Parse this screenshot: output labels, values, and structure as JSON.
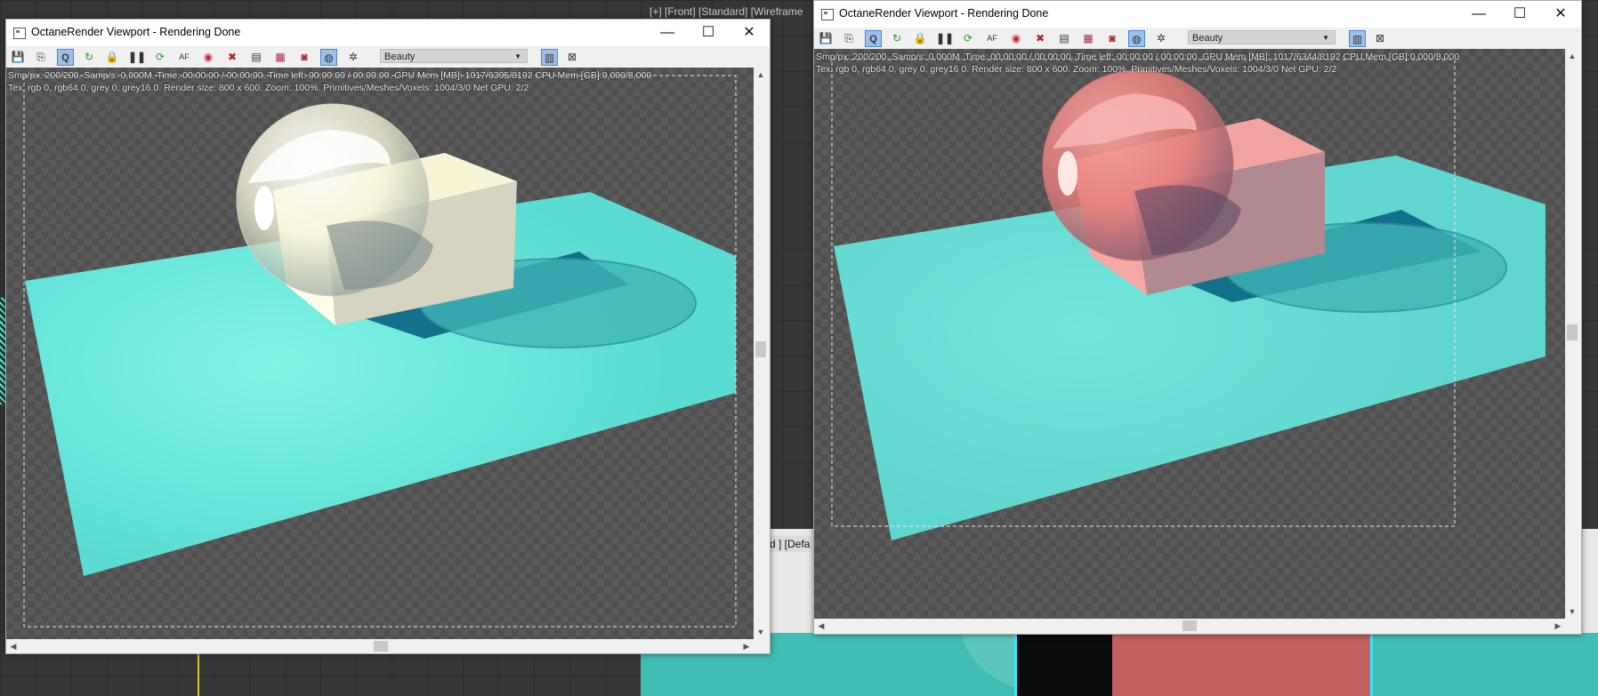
{
  "background": {
    "viewport_label": "[+] [Front] [Standard] [Wireframe",
    "lower_label": "rd ] [Defa"
  },
  "window_left": {
    "title": "OctaneRender Viewport - Rendering Done",
    "pass_select": "Beauty",
    "stats_line1": "Smp/px: 200/200.   Samp/s: 0,000M.   Time: 00:00:00 / 00:00:00.   Time left: 00:00:00 / 00:00:00.   GPU Mem [MB]: 1017/6395/8192   CPU Mem [GB]:0,000/8,000",
    "stats_line2": "Tex: rgb 0, rgb64 0, grey 0, grey16 0.   Render size: 800 x 600.   Zoom: 100%.   Primitives/Meshes/Voxels: 1004/3/0   Net GPU: 2/2",
    "object_tint": "#fffde0"
  },
  "window_right": {
    "title": "OctaneRender Viewport - Rendering Done",
    "pass_select": "Beauty",
    "stats_line1": "Smp/px: 200/200.   Samp/s: 0,000M.   Time: 00:00:00 / 00:00:00.   Time left: 00:00:00 / 00:00:00.   GPU Mem [MB]: 1017/6344/8192   CPU Mem [GB]:0,000/8,000",
    "stats_line2": "Tex: rgb 0, rgb64 0, grey 0, grey16 0.   Render size: 800 x 600.   Zoom: 100%.   Primitives/Meshes/Voxels: 1004/3/0   Net GPU: 2/2",
    "object_tint": "#f08a86"
  },
  "window_buttons": {
    "minimize": "—",
    "maximize": "☐",
    "close": "✕"
  },
  "toolbar_icons": [
    "save-render-icon",
    "copy-render-icon",
    "quick-mode-icon",
    "restart-render-icon",
    "lock-icon",
    "pause-icon",
    "refresh-icon",
    "af-icon",
    "color-picker-icon",
    "region-render-icon",
    "clay-mode-icon",
    "film-region-icon",
    "material-picker-icon",
    "camera-icon",
    "settings-gear-icon",
    "sidebar-panel-icon",
    "fit-view-icon"
  ],
  "colors": {
    "plane": "#5fe3d8",
    "shadow": "#0c6a86",
    "selected_tool": "#9dc0ea"
  }
}
